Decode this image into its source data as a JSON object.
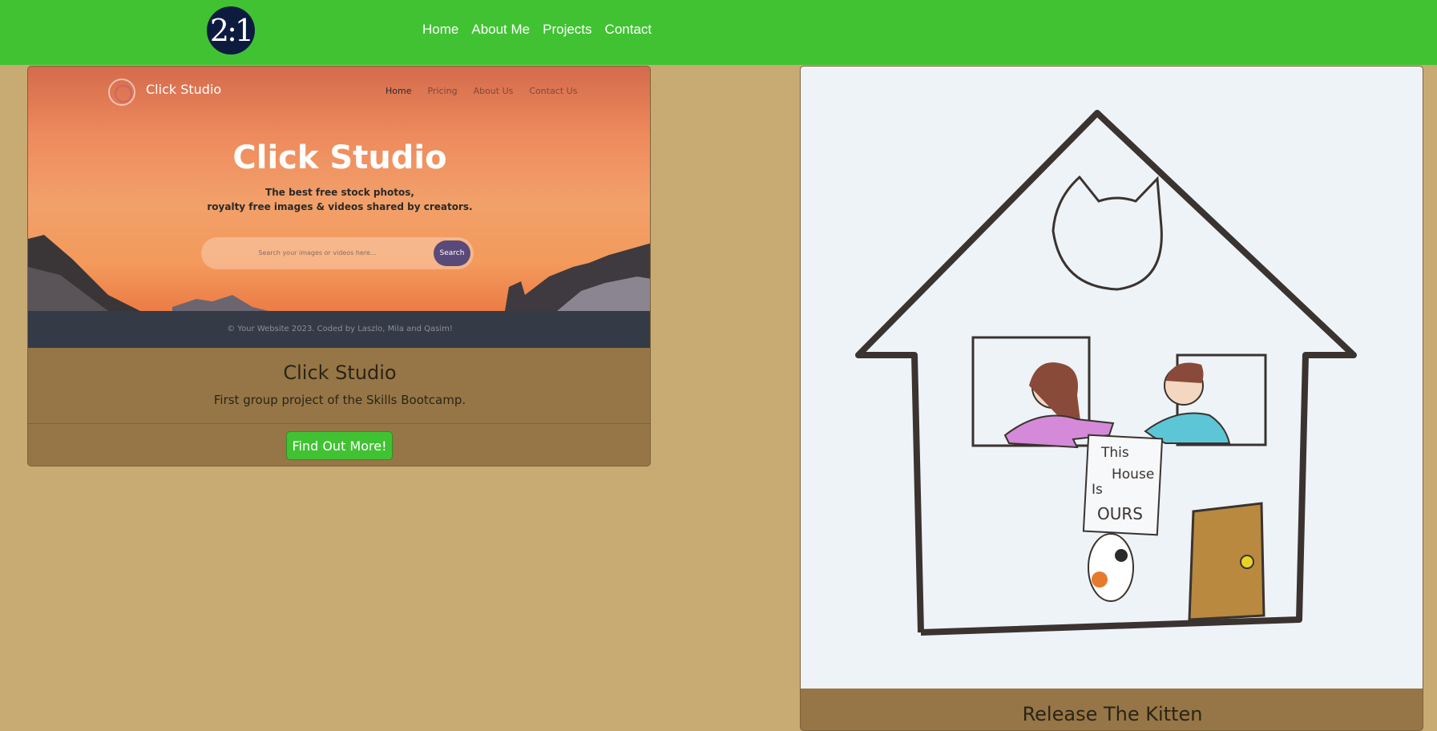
{
  "nav": {
    "logo_text": "2:1",
    "links": [
      "Home",
      "About Me",
      "Projects",
      "Contact"
    ]
  },
  "projects": [
    {
      "screenshot": {
        "brand": "Click Studio",
        "nav": [
          "Home",
          "Pricing",
          "About Us",
          "Contact Us"
        ],
        "hero_title": "Click Studio",
        "hero_line1": "The best free stock photos,",
        "hero_line2": "royalty free images & videos shared by creators.",
        "search_placeholder": "Search your images or videos here...",
        "search_button": "Search",
        "footer": "© Your Website 2023. Coded by Laszlo, Mila and Qasim!"
      },
      "title": "Click Studio",
      "description": "First group project of the Skills Bootcamp.",
      "button_label": "Find Out More!"
    },
    {
      "drawing": {
        "sign_line1": "This",
        "sign_line2": "House",
        "sign_line3": "Is",
        "sign_line4": "OURS"
      },
      "title": "Release The Kitten"
    }
  ],
  "colors": {
    "nav_green": "#41c233",
    "page_bg": "#c8ab72",
    "card_bg": "#967646",
    "logo_navy": "#0d1b3f"
  }
}
